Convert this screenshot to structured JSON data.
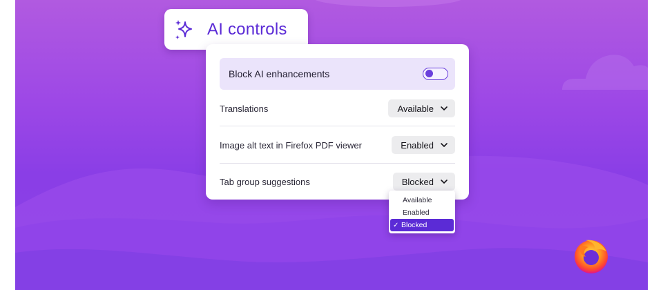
{
  "header": {
    "title": "AI controls",
    "icon": "sparkle-icon"
  },
  "block_ai": {
    "label": "Block AI enhancements",
    "toggle_on": false
  },
  "settings": [
    {
      "label": "Translations",
      "value": "Available"
    },
    {
      "label": "Image alt text in Firefox PDF viewer",
      "value": "Enabled"
    },
    {
      "label": "Tab group suggestions",
      "value": "Blocked"
    }
  ],
  "dropdown": {
    "options": [
      "Available",
      "Enabled",
      "Blocked"
    ],
    "selected": "Blocked",
    "check_glyph": "✓"
  },
  "logo": {
    "name": "firefox-logo-icon"
  },
  "colors": {
    "accent": "#5b2bd6",
    "background_purple": "#9d48e6",
    "highlight_row": "#ebe4fb"
  }
}
